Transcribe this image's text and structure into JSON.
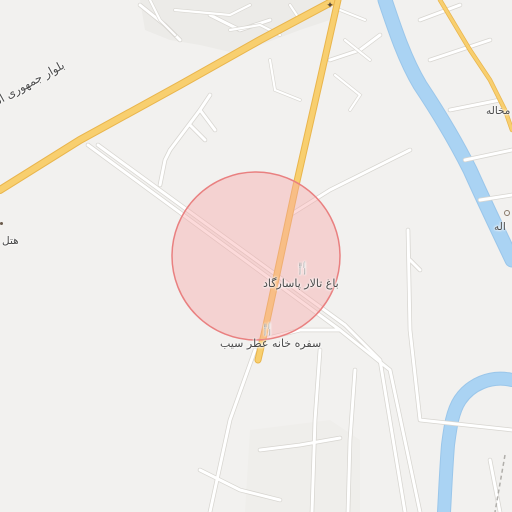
{
  "map": {
    "colors": {
      "land": "#f2f1ef",
      "minor_road": "#ffffff",
      "minor_road_casing": "#d7d5d0",
      "arterial_road": "#f8cf6f",
      "arterial_road_casing": "#e9b54c",
      "river": "#aad3f3",
      "river_edge": "#9ac6ea",
      "marker_fill": "#f7a8a8",
      "marker_stroke": "#e98080",
      "poi_icon": "#5a4a3a",
      "label_text": "#4a4a4a"
    },
    "labels": {
      "boulevard": "بلوار جمهوری اسلامی",
      "garden_hall": "باغ تالار پاسارگاد",
      "restaurant": "سفره خانه عطر سیب",
      "hotel_partial": "هتل",
      "east_label_top": "مخاله",
      "east_label_bottom": "اله"
    },
    "icons": {
      "restaurant": "restaurant-icon",
      "garden_hall": "restaurant-icon",
      "cross_poi": "poi-marker-icon"
    },
    "icon_glyphs": {
      "restaurant": "🍴",
      "cross": "✦"
    }
  }
}
